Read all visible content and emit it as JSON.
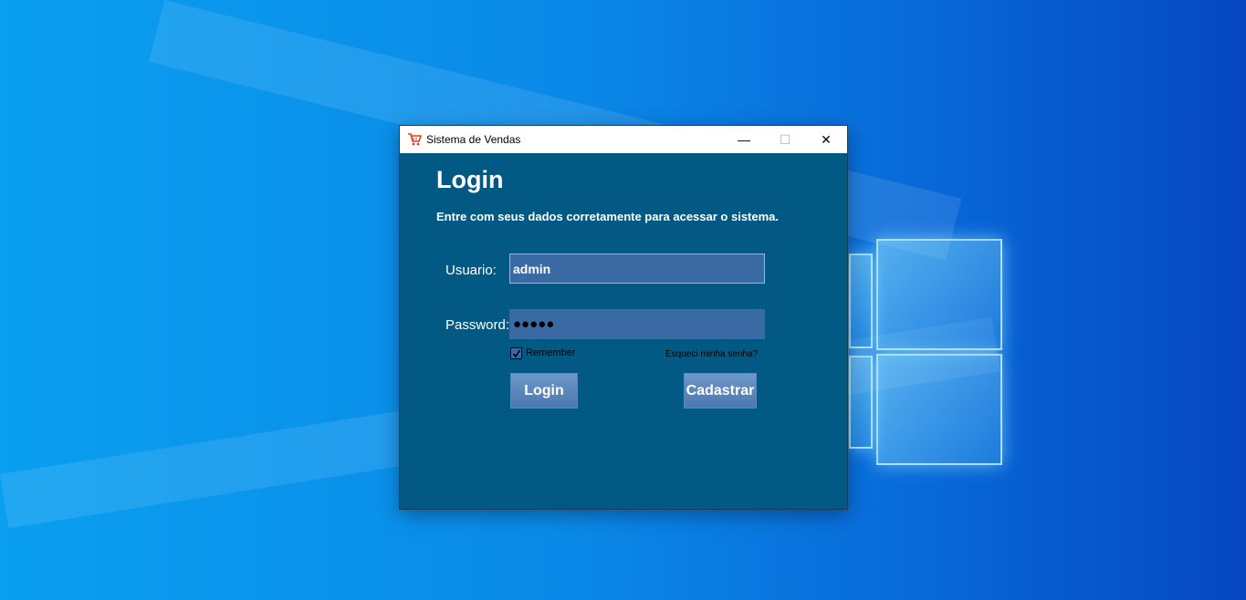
{
  "window": {
    "title": "Sistema de Vendas",
    "minimize_glyph": "—",
    "maximize_glyph": "☐",
    "close_glyph": "✕",
    "app_icon": "shopping-cart-icon"
  },
  "form": {
    "heading": "Login",
    "subtitle": "Entre com seus dados corretamente para acessar o sistema.",
    "username_label": "Usuario:",
    "username_value": "admin",
    "password_label": "Password:",
    "password_value": "●●●●●",
    "remember_label": "Remember",
    "remember_checked": true,
    "forgot_link": "Esqueci minha senha?",
    "login_button": "Login",
    "register_button": "Cadastrar"
  },
  "colors": {
    "panel": "#025a84",
    "field": "#3a6aa3",
    "button": "#5a86bd"
  }
}
